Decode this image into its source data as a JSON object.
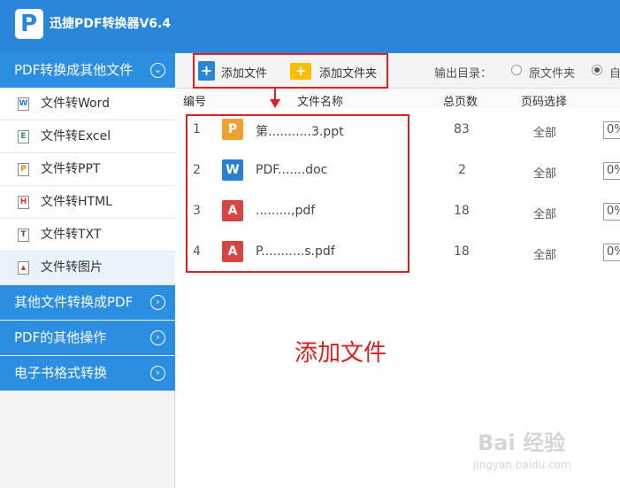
{
  "app": {
    "title": "迅捷PDF转换器V6.4",
    "logo_letter": "P"
  },
  "sidebar": {
    "category_main": "PDF转换成其他文件",
    "items": [
      {
        "label": "文件转Word",
        "icon": "W"
      },
      {
        "label": "文件转Excel",
        "icon": "E"
      },
      {
        "label": "文件转PPT",
        "icon": "P"
      },
      {
        "label": "文件转HTML",
        "icon": "H"
      },
      {
        "label": "文件转TXT",
        "icon": "T"
      },
      {
        "label": "文件转图片",
        "icon": "▲"
      }
    ],
    "categories": [
      "其他文件转换成PDF",
      "PDF的其他操作",
      "电子书格式转换"
    ]
  },
  "toolbar": {
    "add_file": "添加文件",
    "add_folder": "添加文件夹",
    "output_dir_label": "输出目录：",
    "radio_original": "原文件夹",
    "radio_custom": "自"
  },
  "table": {
    "headers": {
      "num": "编号",
      "name": "文件名称",
      "pages": "总页数",
      "range": "页码选择"
    },
    "rows": [
      {
        "num": "1",
        "type": "P",
        "kind": "ppt",
        "name": "第...........3.ppt",
        "pages": "83",
        "range": "全部",
        "pct": "0%"
      },
      {
        "num": "2",
        "type": "W",
        "kind": "doc",
        "name": "PDF.......doc",
        "pages": "2",
        "range": "全部",
        "pct": "0%"
      },
      {
        "num": "3",
        "type": "A",
        "kind": "pdf",
        "name": ".........,pdf",
        "pages": "18",
        "range": "全部",
        "pct": "0%"
      },
      {
        "num": "4",
        "type": "A",
        "kind": "pdf",
        "name": "P...........s.pdf",
        "pages": "18",
        "range": "全部",
        "pct": "0%"
      }
    ]
  },
  "caption": "添加文件",
  "watermark": {
    "main": "Bai 经验",
    "sub": "jingyan.baidu.com"
  }
}
